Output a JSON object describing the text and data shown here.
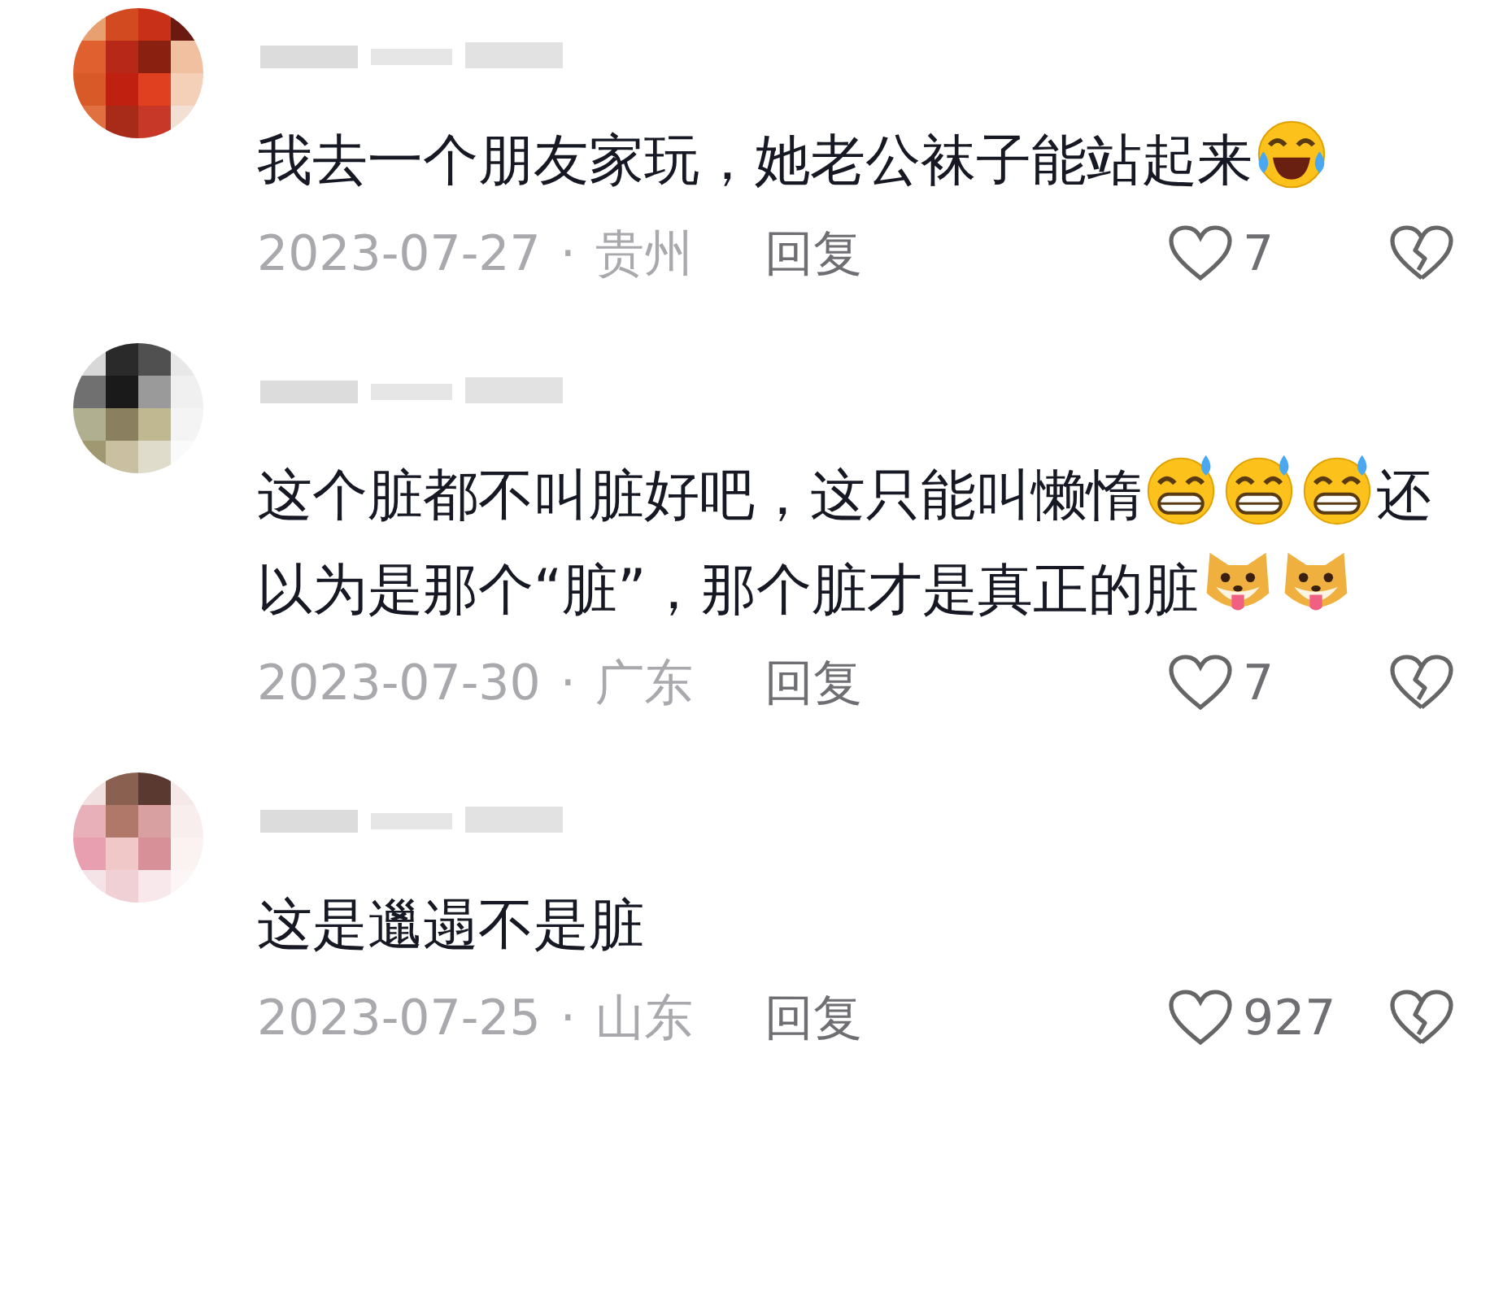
{
  "comments": [
    {
      "segments": [
        {
          "kind": "text",
          "text": "我去一个朋友家玩，她老公袜子能站起来"
        },
        {
          "kind": "tearlaugh"
        }
      ],
      "date": "2023-07-27",
      "separator": "·",
      "location": "贵州",
      "reply": "回复",
      "likes": "7",
      "liked": false,
      "disliked": false
    },
    {
      "segments": [
        {
          "kind": "text",
          "text": "这个脏都不叫脏好吧，这只能叫懒惰"
        },
        {
          "kind": "sweatgrin"
        },
        {
          "kind": "sweatgrin"
        },
        {
          "kind": "sweatgrin"
        },
        {
          "kind": "text",
          "text": "还以为是那个“脏”，那个脏才是真正的脏"
        },
        {
          "kind": "dog"
        },
        {
          "kind": "dog"
        }
      ],
      "date": "2023-07-30",
      "separator": "·",
      "location": "广东",
      "reply": "回复",
      "likes": "7",
      "liked": false,
      "disliked": false
    },
    {
      "segments": [
        {
          "kind": "text",
          "text": "这是邋遢不是脏"
        }
      ],
      "date": "2023-07-25",
      "separator": "·",
      "location": "山东",
      "reply": "回复",
      "likes": "927",
      "liked": false,
      "disliked": false
    }
  ]
}
